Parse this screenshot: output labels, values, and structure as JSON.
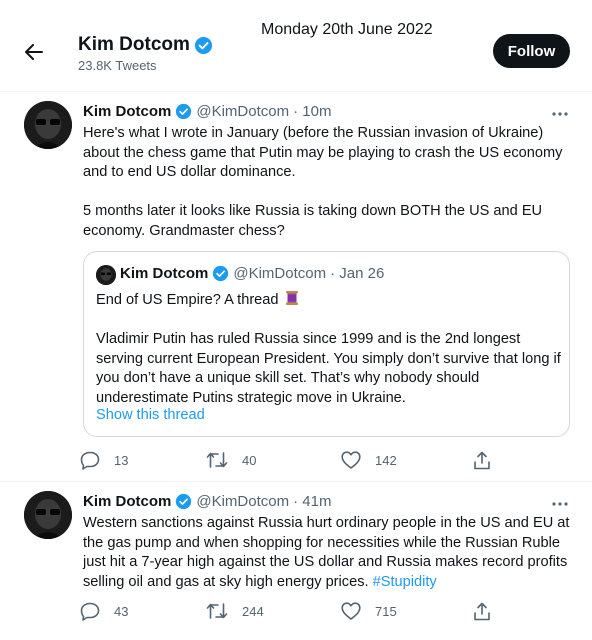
{
  "header": {
    "name": "Kim Dotcom",
    "tweet_count": "23.8K Tweets",
    "follow_label": "Follow",
    "date_overlay": "Monday 20th June 2022"
  },
  "tweets": [
    {
      "author": "Kim Dotcom",
      "handle": "@KimDotcom",
      "time": "· 10m",
      "lines": [
        "Here's what I wrote in January (before the Russian invasion of Ukraine)",
        "about the chess game that Putin may be playing to crash the US economy",
        "and to end US dollar dominance.",
        "",
        "5 months later it looks like Russia is taking down BOTH the US and EU",
        "economy. Grandmaster chess?"
      ],
      "quote": {
        "author": "Kim Dotcom",
        "handle": "@KimDotcom",
        "time": "· Jan 26",
        "lines": [
          "End of US Empire? A thread",
          "",
          "Vladimir Putin has ruled Russia since 1999 and is the 2nd longest",
          "serving current European President. You simply don’t survive that long if",
          "you don’t have a unique skill set. That’s why nobody should",
          "underestimate Putins strategic move in Ukraine."
        ],
        "emoji": "thread-spool-emoji",
        "show_thread": "Show this thread"
      },
      "replies": "13",
      "retweets": "40",
      "likes": "142"
    },
    {
      "author": "Kim Dotcom",
      "handle": "@KimDotcom",
      "time": "· 41m",
      "lines": [
        "Western sanctions against Russia hurt ordinary people in the US and EU at",
        "the gas pump and when shopping for necessities while the Russian Ruble",
        "just hit a 7-year high against the US dollar and Russia makes record profits"
      ],
      "last_line": "selling oil and gas at sky high energy prices. ",
      "hashtag": "#Stupidity",
      "replies": "43",
      "retweets": "244",
      "likes": "715"
    }
  ],
  "icons": {
    "back": "arrow-left-icon",
    "verified": "verified-badge-icon",
    "more": "more-dots-icon",
    "reply": "reply-icon",
    "retweet": "retweet-icon",
    "like": "heart-icon",
    "share": "share-icon"
  },
  "colors": {
    "accent": "#1d9bf0",
    "text": "#0f1419",
    "secondary": "#536471",
    "border": "#cfd9de"
  }
}
